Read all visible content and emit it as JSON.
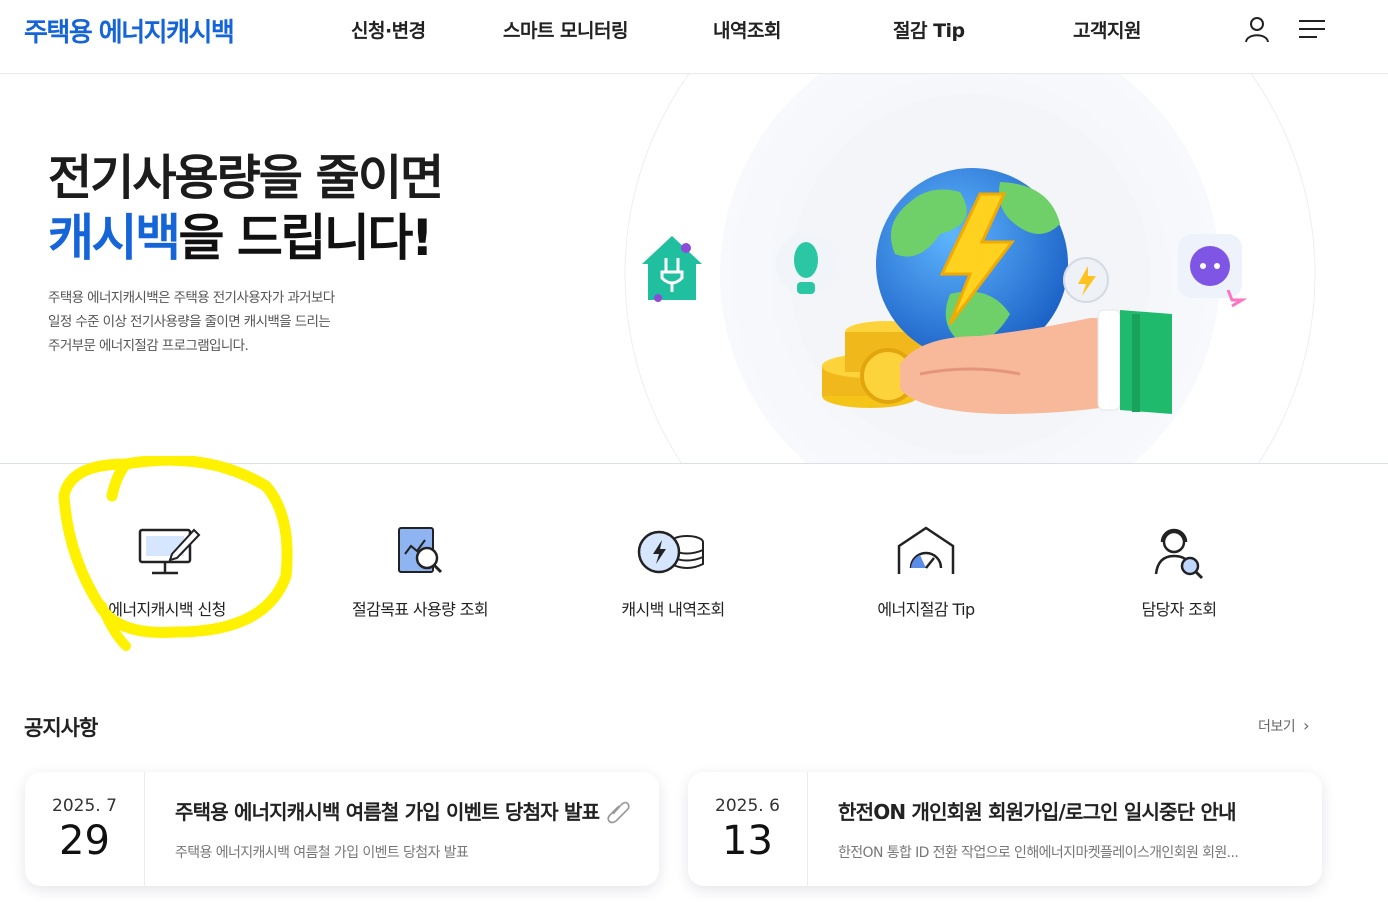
{
  "header": {
    "logo": "주택용 에너지캐시백",
    "nav": [
      "신청·변경",
      "스마트 모니터링",
      "내역조회",
      "절감 Tip",
      "고객지원"
    ],
    "user_icon": "user-icon",
    "menu_icon": "hamburger-menu-icon"
  },
  "hero": {
    "title_line1": "전기사용량을 줄이면",
    "title_accent": "캐시백",
    "title_rest": "을 드립니다!",
    "desc_line1": "주택용 에너지캐시백은 주택용 전기사용자가 과거보다",
    "desc_line2": "일정 수준 이상 전기사용량을 줄이면 캐시백을 드리는",
    "desc_line3": "주거부문 에너지절감 프로그램입니다.",
    "illustration": "globe-lightning-hand-coins-illustration"
  },
  "quick_menu": [
    {
      "label": "에너지캐시백 신청",
      "icon": "monitor-pen-icon"
    },
    {
      "label": "절감목표 사용량 조회",
      "icon": "document-chart-search-icon"
    },
    {
      "label": "캐시백 내역조회",
      "icon": "bolt-coins-icon"
    },
    {
      "label": "에너지절감 Tip",
      "icon": "house-gauge-icon"
    },
    {
      "label": "담당자 조회",
      "icon": "support-agent-search-icon"
    }
  ],
  "notice": {
    "title": "공지사항",
    "more": "더보기",
    "items": [
      {
        "ym": "2025. 7",
        "day": "29",
        "headline": "주택용 에너지캐시백 여름철 가입 이벤트 당첨자 발표",
        "sub": "주택용 에너지캐시백 여름철 가입 이벤트 당첨자 발표",
        "attachment": true
      },
      {
        "ym": "2025. 6",
        "day": "13",
        "headline": "한전ON 개인회원 회원가입/로그인 일시중단 안내",
        "sub": "한전ON 통합 ID 전환 작업으로 인해에너지마켓플레이스개인회원 회원...",
        "attachment": false
      }
    ]
  },
  "colors": {
    "brand_blue": "#1565d8",
    "highlight_yellow": "#fff200"
  }
}
